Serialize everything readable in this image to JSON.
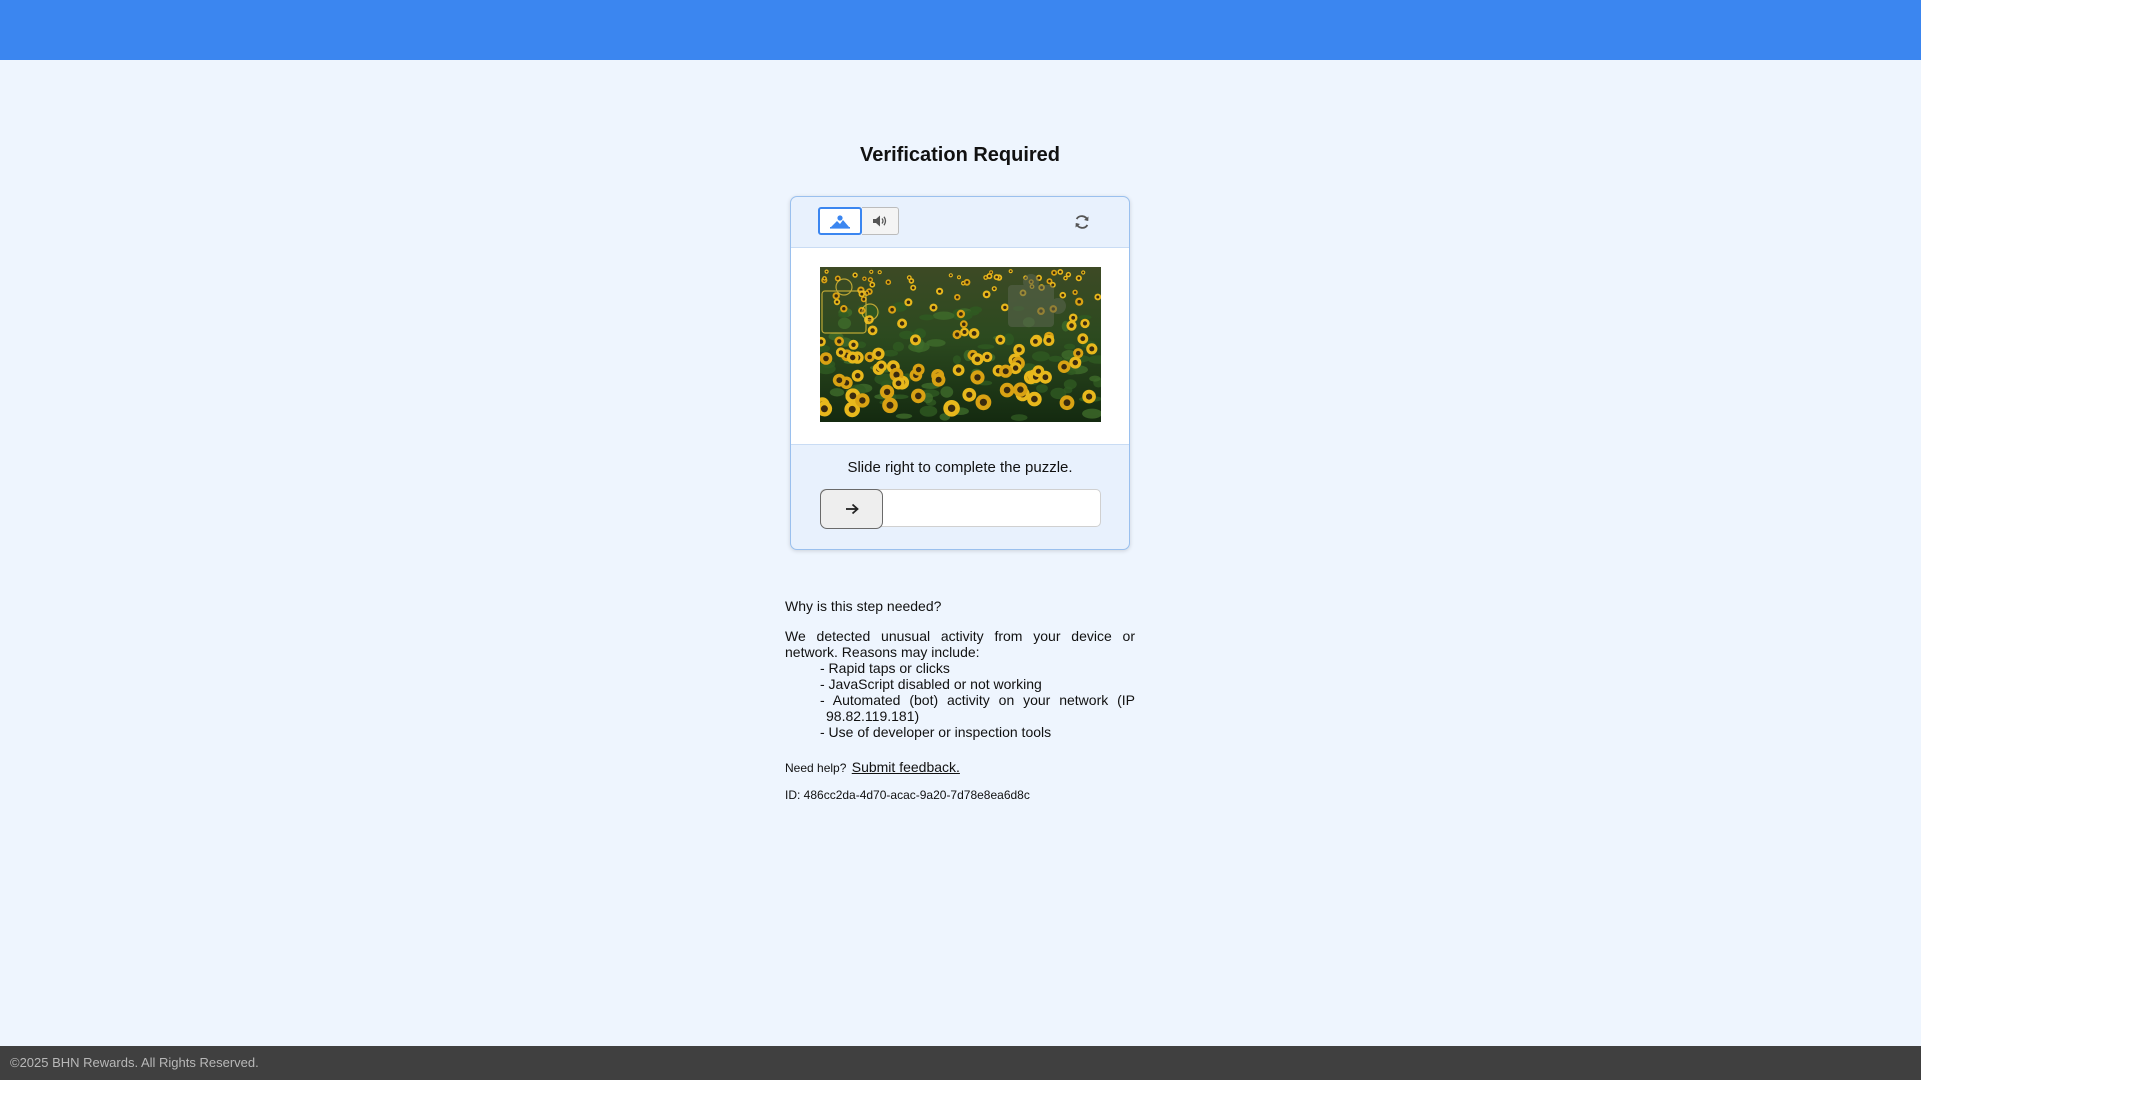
{
  "header": {
    "color": "#3b86f0"
  },
  "main": {
    "title": "Verification Required"
  },
  "captcha": {
    "modes": [
      {
        "name": "image",
        "icon": "image-mountain-icon",
        "selected": true
      },
      {
        "name": "audio",
        "icon": "speaker-icon",
        "selected": false
      }
    ],
    "refresh_icon": "refresh-icon",
    "image_description_icon": "sunflower-field-puzzle-image",
    "prompt": "Slide right to complete the puzzle.",
    "slider_icon": "arrow-right-icon",
    "slider_progress": 0
  },
  "info": {
    "question": "Why is this step needed?",
    "intro": "We detected unusual activity from your device or network. Reasons may include:",
    "reasons": [
      "- Rapid taps or clicks",
      "- JavaScript disabled or not working",
      "- Automated (bot) activity on your network (IP 98.82.119.181)",
      "- Use of developer or inspection tools"
    ],
    "help_prefix": "Need help?",
    "help_link": "Submit feedback.",
    "id_text": "ID: 486cc2da-4d70-acac-9a20-7d78e8ea6d8c"
  },
  "footer": {
    "copyright": "©2025 BHN Rewards. All Rights Reserved."
  },
  "colors": {
    "accent": "#3b86f0",
    "background": "#eef5fe",
    "footer": "#404040"
  }
}
